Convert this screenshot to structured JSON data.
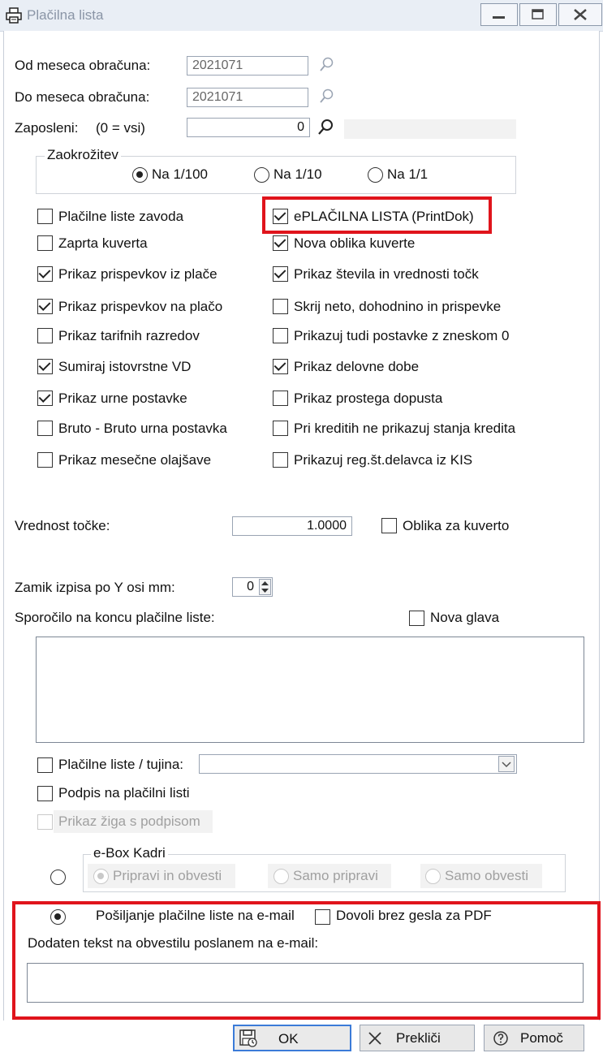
{
  "window": {
    "title": "Plačilna lista"
  },
  "fields": {
    "od_meseca_label": "Od meseca obračuna:",
    "od_meseca_value": "2021071",
    "do_meseca_label": "Do meseca obračuna:",
    "do_meseca_value": "2021071",
    "zaposleni_label": "Zaposleni:",
    "zaposleni_hint": "(0 = vsi)",
    "zaposleni_value": "0"
  },
  "rounding": {
    "legend": "Zaokrožitev",
    "options": [
      "Na 1/100",
      "Na 1/10",
      "Na 1/1"
    ],
    "selected": "Na 1/100"
  },
  "checkboxes_left": [
    {
      "label": "Plačilne liste zavoda",
      "checked": false
    },
    {
      "label": "Zaprta kuverta",
      "checked": false
    },
    {
      "label": "Prikaz prispevkov iz plače",
      "checked": true
    },
    {
      "label": "Prikaz prispevkov na plačo",
      "checked": true
    },
    {
      "label": "Prikaz tarifnih razredov",
      "checked": false
    },
    {
      "label": "Sumiraj istovrstne VD",
      "checked": true
    },
    {
      "label": "Prikaz urne postavke",
      "checked": true
    },
    {
      "label": "Bruto - Bruto urna postavka",
      "checked": false
    },
    {
      "label": "Prikaz mesečne olajšave",
      "checked": false
    }
  ],
  "checkboxes_right": [
    {
      "label": "ePLAČILNA LISTA (PrintDok)",
      "checked": true
    },
    {
      "label": "Nova oblika kuverte",
      "checked": true
    },
    {
      "label": "Prikaz števila in vrednosti točk",
      "checked": true
    },
    {
      "label": "Skrij neto, dohodnino in prispevke",
      "checked": false
    },
    {
      "label": "Prikazuj tudi postavke z zneskom 0",
      "checked": false
    },
    {
      "label": "Prikaz delovne dobe",
      "checked": true
    },
    {
      "label": "Prikaz prostega dopusta",
      "checked": false
    },
    {
      "label": "Pri kreditih ne prikazuj stanja kredita",
      "checked": false
    },
    {
      "label": "Prikazuj reg.št.delavca iz KIS",
      "checked": false
    }
  ],
  "point_value": {
    "label": "Vrednost točke:",
    "value": "1.0000",
    "envelope_label": "Oblika za kuverto"
  },
  "offset": {
    "label": "Zamik izpisa po Y osi mm:",
    "value": "0"
  },
  "message": {
    "label": "Sporočilo na koncu plačilne liste:",
    "nova_glava_label": "Nova glava"
  },
  "foreign": {
    "label": "Plačilne liste / tujina:",
    "value": ""
  },
  "signature": {
    "label": "Podpis na plačilni listi",
    "stamp_label": "Prikaz žiga s podpisom"
  },
  "ebox": {
    "legend": "e-Box Kadri",
    "options": [
      "Pripravi in obvesti",
      "Samo pripravi",
      "Samo obvesti"
    ]
  },
  "email": {
    "label": "Pošiljanje plačilne liste na e-mail",
    "allow_label": "Dovoli brez gesla za PDF",
    "extra_label": "Dodaten tekst na obvestilu poslanem na e-mail:",
    "extra_value": ""
  },
  "buttons": {
    "ok": "OK",
    "cancel": "Prekliči",
    "help": "Pomoč"
  },
  "colors": {
    "highlight": "#e0141c",
    "ok_border": "#3b7bd8"
  }
}
